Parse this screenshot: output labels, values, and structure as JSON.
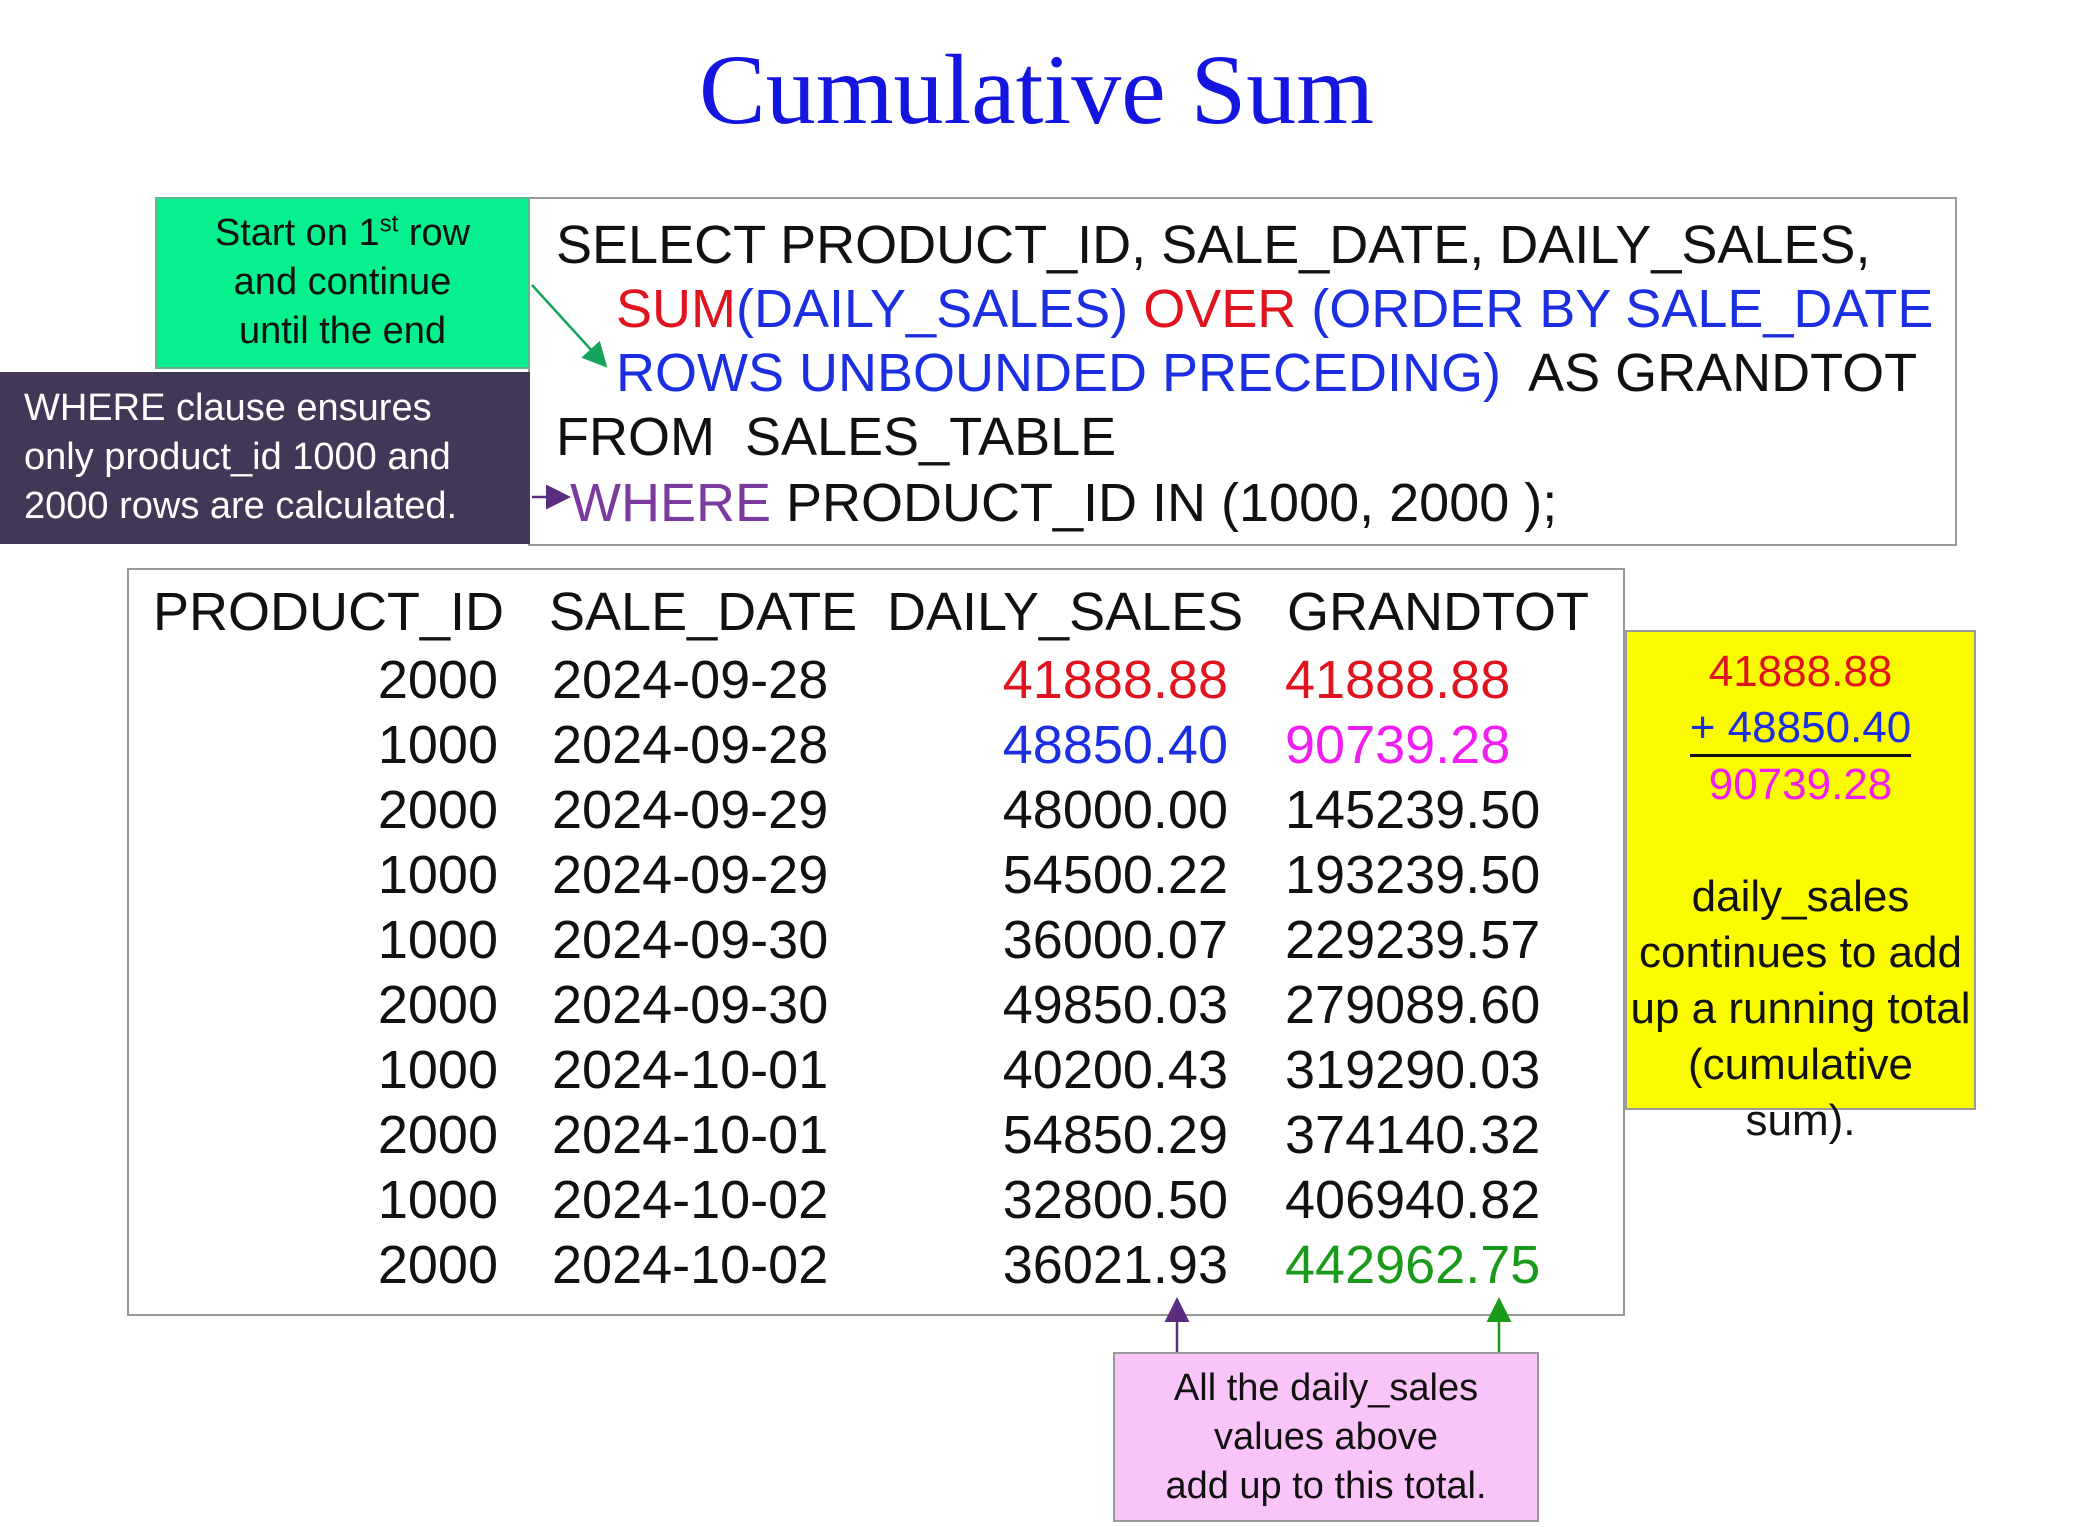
{
  "title": "Cumulative Sum",
  "query": {
    "line1": "SELECT PRODUCT_ID, SALE_DATE, DAILY_SALES,",
    "line2_sum": "SUM",
    "line2_args": "(DAILY_SALES)",
    "line2_over": "OVER",
    "line2_order": "(ORDER BY SALE_DATE",
    "line3_rows": "ROWS UNBOUNDED PRECEDING)",
    "line3_alias": "AS GRANDTOT",
    "line4": "FROM  SALES_TABLE",
    "line5_where": "WHERE",
    "line5_rest": " PRODUCT_ID IN (1000, 2000 );"
  },
  "notes": {
    "start_pre": "Start on 1",
    "start_sup": "st",
    "start_post": " row",
    "start_line2": "and continue",
    "start_line3": "until the end",
    "where_line1": "WHERE clause ensures",
    "where_line2": "only product_id 1000 and",
    "where_line3": "2000 rows are calculated.",
    "yellow_a": "41888.88",
    "yellow_b": "+ 48850.40",
    "yellow_c": "90739.28",
    "yellow_d1": "daily_sales",
    "yellow_d2": "continues to add",
    "yellow_d3": "up a running total",
    "yellow_d4": "(cumulative sum).",
    "pink_1": "All the daily_sales",
    "pink_2": "values above",
    "pink_3": "add up to this total."
  },
  "table": {
    "headers": [
      "PRODUCT_ID",
      "SALE_DATE",
      "DAILY_SALES",
      "GRANDTOT"
    ],
    "rows": [
      [
        "2000",
        "2024-09-28",
        "41888.88",
        "41888.88"
      ],
      [
        "1000",
        "2024-09-28",
        "48850.40",
        "90739.28"
      ],
      [
        "2000",
        "2024-09-29",
        "48000.00",
        "145239.50"
      ],
      [
        "1000",
        "2024-09-29",
        "54500.22",
        "193239.50"
      ],
      [
        "1000",
        "2024-09-30",
        "36000.07",
        "229239.57"
      ],
      [
        "2000",
        "2024-09-30",
        "49850.03",
        "279089.60"
      ],
      [
        "1000",
        "2024-10-01",
        "40200.43",
        "319290.03"
      ],
      [
        "2000",
        "2024-10-01",
        "54850.29",
        "374140.32"
      ],
      [
        "1000",
        "2024-10-02",
        "32800.50",
        "406940.82"
      ],
      [
        "2000",
        "2024-10-02",
        "36021.93",
        "442962.75"
      ]
    ]
  },
  "colors": {
    "title": "#1515e0",
    "red": "#e0141e",
    "blue": "#1b2fe0",
    "magenta": "#f01ef0",
    "green": "#1a9a1a",
    "purple": "#7a3a9e"
  }
}
